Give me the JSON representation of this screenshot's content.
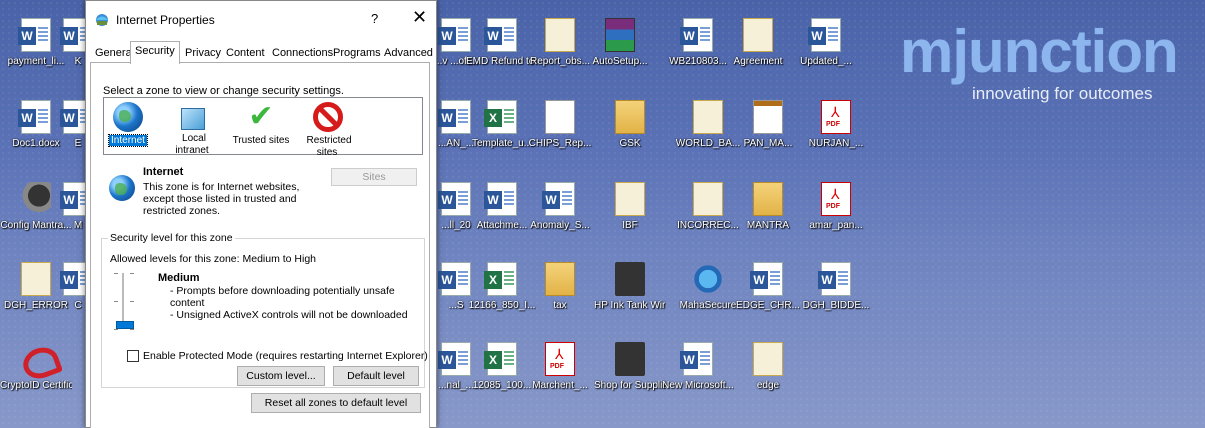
{
  "dialog": {
    "title": "Internet Properties",
    "help": "?",
    "close": "✕",
    "tabs": [
      "General",
      "Security",
      "Privacy",
      "Content",
      "Connections",
      "Programs",
      "Advanced"
    ],
    "active_tab": "Security",
    "zone_prompt": "Select a zone to view or change security settings.",
    "zones": [
      {
        "label": "Internet",
        "selected": true,
        "icon": "globe-icon"
      },
      {
        "label": "Local intranet",
        "selected": false,
        "icon": "intranet-icon"
      },
      {
        "label": "Trusted sites",
        "selected": false,
        "icon": "checkmark-icon"
      },
      {
        "label": "Restricted sites",
        "selected": false,
        "icon": "restricted-icon"
      }
    ],
    "zone_info": {
      "title": "Internet",
      "description": "This zone is for Internet websites, except those listed in trusted and restricted zones.",
      "sites_button": "Sites"
    },
    "security_level": {
      "group_title": "Security level for this zone",
      "allowed": "Allowed levels for this zone: Medium to High",
      "level_name": "Medium",
      "bullets": [
        "- Prompts before downloading potentially unsafe content",
        "- Unsigned ActiveX controls will not be downloaded"
      ]
    },
    "protected_mode": {
      "label": "Enable Protected Mode (requires restarting Internet Explorer)",
      "checked": false
    },
    "buttons": {
      "custom": "Custom level...",
      "default": "Default level",
      "reset": "Reset all zones to default level"
    }
  },
  "brand": {
    "logo": "mjunction",
    "tagline": "innovating for outcomes"
  },
  "desktop_icons": [
    {
      "label": "payment_li...",
      "type": "word"
    },
    {
      "label": "K",
      "type": "word"
    },
    {
      "label": "Doc1.docx",
      "type": "word"
    },
    {
      "label": "E",
      "type": "word"
    },
    {
      "label": "Config Mantra...",
      "type": "fingerprint"
    },
    {
      "label": "M",
      "type": "word"
    },
    {
      "label": "DGH_ERROR",
      "type": "pdfdoc"
    },
    {
      "label": "C",
      "type": "word"
    },
    {
      "label": "CryptoID Certifica...",
      "type": "crypto"
    },
    {
      "label": "...v ...oft...",
      "type": "word"
    },
    {
      "label": "EMD Refund to unsuccessf...",
      "type": "word"
    },
    {
      "label": "Report_obs...",
      "type": "pdfdoc"
    },
    {
      "label": "AutoSetup...",
      "type": "winrar"
    },
    {
      "label": "WB210803...",
      "type": "word"
    },
    {
      "label": "Agreement",
      "type": "pdfdoc"
    },
    {
      "label": "Updated_...",
      "type": "word"
    },
    {
      "label": "...AN_...",
      "type": "word"
    },
    {
      "label": "Template_u...",
      "type": "excel"
    },
    {
      "label": "CHIPS_Rep...",
      "type": "blank"
    },
    {
      "label": "GSK",
      "type": "folder"
    },
    {
      "label": "WORLD_BA...",
      "type": "pdfdoc"
    },
    {
      "label": "PAN_MA...",
      "type": "card"
    },
    {
      "label": "NURJAN_...",
      "type": "pdf"
    },
    {
      "label": "...ll_20",
      "type": "word"
    },
    {
      "label": "Attachme...",
      "type": "word"
    },
    {
      "label": "Anomaly_S...",
      "type": "word"
    },
    {
      "label": "IBF",
      "type": "pdfdoc"
    },
    {
      "label": "INCORREC...",
      "type": "pdfdoc"
    },
    {
      "label": "MANTRA",
      "type": "folder"
    },
    {
      "label": "amar_pan...",
      "type": "pdf"
    },
    {
      "label": "...S",
      "type": "word"
    },
    {
      "label": "12166_850_I...",
      "type": "excel"
    },
    {
      "label": "tax",
      "type": "folder"
    },
    {
      "label": "HP Ink Tank Wireless 4...",
      "type": "printer"
    },
    {
      "label": "MahaSecure",
      "type": "app"
    },
    {
      "label": "EDGE_CHR...",
      "type": "word"
    },
    {
      "label": "DGH_BIDDE...",
      "type": "word"
    },
    {
      "label": "...nal_...",
      "type": "word"
    },
    {
      "label": "12085_100...",
      "type": "excel"
    },
    {
      "label": "Marchent_...",
      "type": "pdf"
    },
    {
      "label": "Shop for Supplies - ...",
      "type": "printer"
    },
    {
      "label": "New Microsoft...",
      "type": "word"
    },
    {
      "label": "edge",
      "type": "pdfdoc"
    }
  ]
}
